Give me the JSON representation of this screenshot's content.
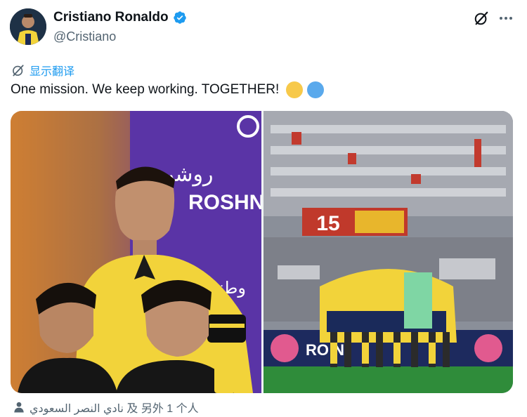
{
  "author": {
    "name": "Cristiano Ronaldo",
    "handle": "@Cristiano",
    "verified": true
  },
  "translate_label": "显示翻译",
  "tweet": {
    "text": "One mission. We keep working. TOGETHER!",
    "emojis": [
      "yellow-circle",
      "blue-circle"
    ]
  },
  "media": {
    "left": {
      "sponsor_arabic": "روشن",
      "sponsor": "ROSHN",
      "arabic_sign": "وطني ات"
    },
    "right": {
      "scoreboard_number": "15",
      "board_text": "RO N"
    }
  },
  "tagged": "نادي النصر السعودي 及 另外 1 个人",
  "colors": {
    "accent": "#1d9bf0",
    "text": "#0f1419",
    "muted": "#536471",
    "kit_yellow": "#f2d33a",
    "kit_navy": "#1a2a5a",
    "emoji_yellow": "#f7c94a",
    "emoji_blue": "#5aa9ec"
  },
  "icons": [
    "verified-badge-icon",
    "grok-icon",
    "more-icon",
    "translate-icon",
    "person-tag-icon"
  ]
}
